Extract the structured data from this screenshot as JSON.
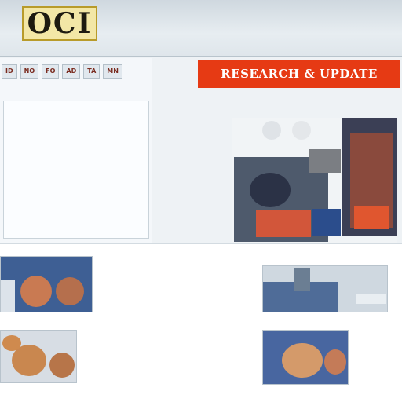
{
  "header": {
    "logo_text": "OCI",
    "lines": [
      "",
      "",
      "",
      ""
    ]
  },
  "nav": {
    "tabs": [
      "ID",
      "NO",
      "FO",
      "AD",
      "TA",
      "MN"
    ]
  },
  "left_panel": {
    "rows": [
      "",
      "",
      "",
      "",
      "",
      "",
      "",
      "",
      ""
    ],
    "highlight": ""
  },
  "banner": {
    "text": "RESEARCH & UPDATE"
  },
  "right": {
    "subhead": "",
    "subline": "",
    "label_a": "",
    "label_b": ""
  },
  "mid": {
    "title": "",
    "sub": "",
    "caption_1": "",
    "caption_2": ""
  },
  "colors": {
    "accent_red": "#e63a14",
    "link_blue": "#3c6f96",
    "header_bg": "#dfe6eb"
  }
}
